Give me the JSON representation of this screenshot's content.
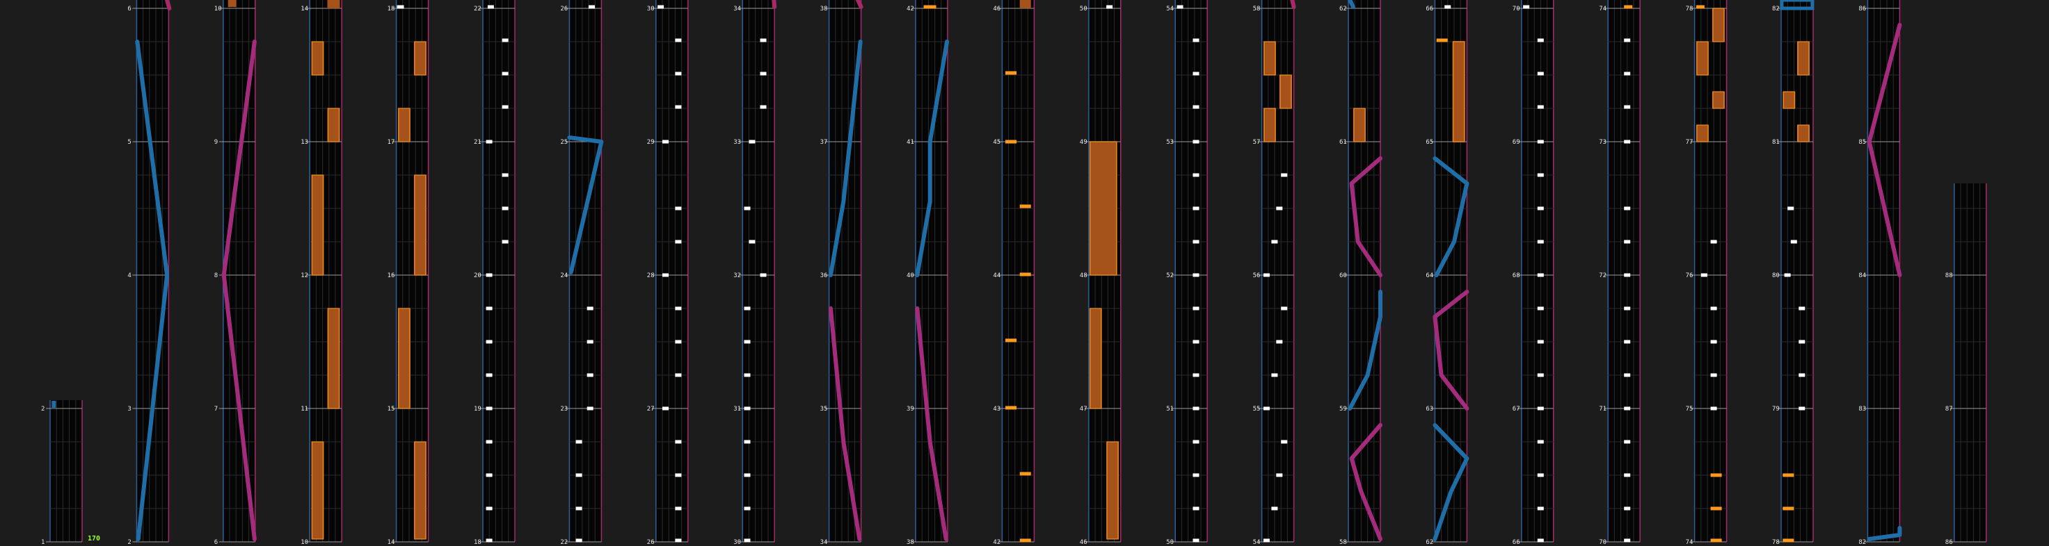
{
  "chart_data": {
    "type": "rhythm-game chart (measure view)",
    "combo_text": "170",
    "colors": {
      "background": "#1c1c1c",
      "lane_background": "#050505",
      "grid": "#2c2c2c",
      "measure_line": "#9a9a9a",
      "left_border": "#2f5f9a",
      "right_border": "#a8286a",
      "tap": "#ffffff",
      "hold": "#ff9a1f",
      "hold_body": "#a6521b",
      "slide_left": "#1f6ea8",
      "slide_right": "#a52c7c",
      "flick": "#ff9a1f",
      "combo": "#9bff2e"
    },
    "columns": [
      {
        "measures": [
          2,
          1
        ]
      },
      {
        "measures": [
          6,
          5,
          4,
          3,
          2
        ]
      },
      {
        "measures": [
          10,
          9,
          8,
          7,
          6
        ]
      },
      {
        "measures": [
          14,
          13,
          12,
          11,
          10
        ]
      },
      {
        "measures": [
          18,
          17,
          16,
          15,
          14
        ]
      },
      {
        "measures": [
          22,
          21,
          20,
          19,
          18
        ]
      },
      {
        "measures": [
          26,
          25,
          24,
          23,
          22
        ]
      },
      {
        "measures": [
          30,
          29,
          28,
          27,
          26
        ]
      },
      {
        "measures": [
          34,
          33,
          32,
          31,
          30
        ]
      },
      {
        "measures": [
          38,
          37,
          36,
          35,
          34
        ]
      },
      {
        "measures": [
          42,
          41,
          40,
          39,
          38
        ]
      },
      {
        "measures": [
          46,
          45,
          44,
          43,
          42
        ]
      },
      {
        "measures": [
          50,
          49,
          48,
          47,
          46
        ]
      },
      {
        "measures": [
          54,
          53,
          52,
          51,
          50
        ]
      },
      {
        "measures": [
          58,
          57,
          56,
          55,
          54
        ]
      },
      {
        "measures": [
          62,
          61,
          60,
          59,
          58
        ]
      },
      {
        "measures": [
          66,
          65,
          64,
          63,
          62
        ]
      },
      {
        "measures": [
          70,
          69,
          68,
          67,
          66
        ]
      },
      {
        "measures": [
          74,
          73,
          72,
          71,
          70
        ]
      },
      {
        "measures": [
          78,
          77,
          76,
          75,
          74
        ]
      },
      {
        "measures": [
          82,
          81,
          80,
          79,
          78
        ]
      },
      {
        "measures": [
          86,
          85,
          84,
          83,
          82
        ]
      },
      {
        "measures": [
          88,
          87,
          86
        ]
      }
    ]
  }
}
